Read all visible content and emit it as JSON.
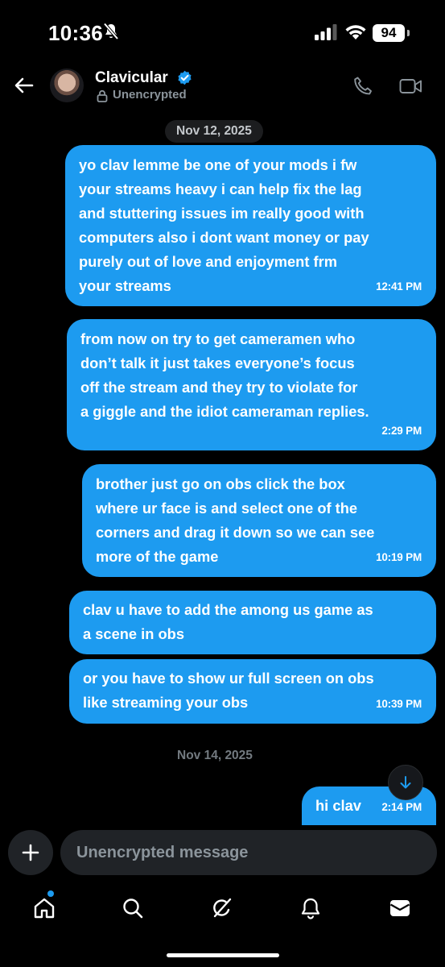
{
  "status_bar": {
    "time": "10:36",
    "battery": "94"
  },
  "header": {
    "contact_name": "Clavicular",
    "encryption_status": "Unencrypted"
  },
  "conversation": {
    "dates": [
      "Nov 12, 2025",
      "Nov 14, 2025"
    ],
    "messages": [
      {
        "lines": [
          "yo clav lemme be one of your mods i fw",
          "your streams heavy i can help fix the lag",
          "and stuttering issues im really good with",
          "computers also i dont want money or pay",
          "purely out of love and enjoyment frm",
          "your streams"
        ],
        "time": "12:41 PM"
      },
      {
        "lines": [
          "from now on try to get cameramen who",
          "don’t talk it just takes everyone’s focus",
          "off the stream and they try to violate for",
          "a giggle and the idiot cameraman replies."
        ],
        "time": "2:29 PM"
      },
      {
        "lines": [
          "brother just go on obs click the box",
          "where ur face is and select one of the",
          "corners and drag it down so we can see",
          "more of the game"
        ],
        "time": "10:19 PM"
      },
      {
        "lines": [
          "clav u have to add the among us game as",
          "a scene in obs"
        ],
        "time": ""
      },
      {
        "lines": [
          "or you have to show ur full screen on obs",
          "like streaming your obs"
        ],
        "time": "10:39 PM"
      },
      {
        "lines": [
          "hi clav"
        ],
        "time": "2:14 PM"
      }
    ]
  },
  "composer": {
    "placeholder": "Unencrypted message"
  },
  "icons": {
    "back": "arrow-left-icon",
    "verified": "verified-badge-icon",
    "lock": "lock-icon",
    "call": "phone-icon",
    "video": "video-camera-icon",
    "scroll": "arrow-down-icon",
    "add": "plus-icon",
    "tabs": [
      "home-icon",
      "search-icon",
      "grok-icon",
      "bell-icon",
      "mail-icon"
    ]
  },
  "colors": {
    "bubble": "#1d9bf0",
    "background": "#000000",
    "input": "#202327"
  }
}
